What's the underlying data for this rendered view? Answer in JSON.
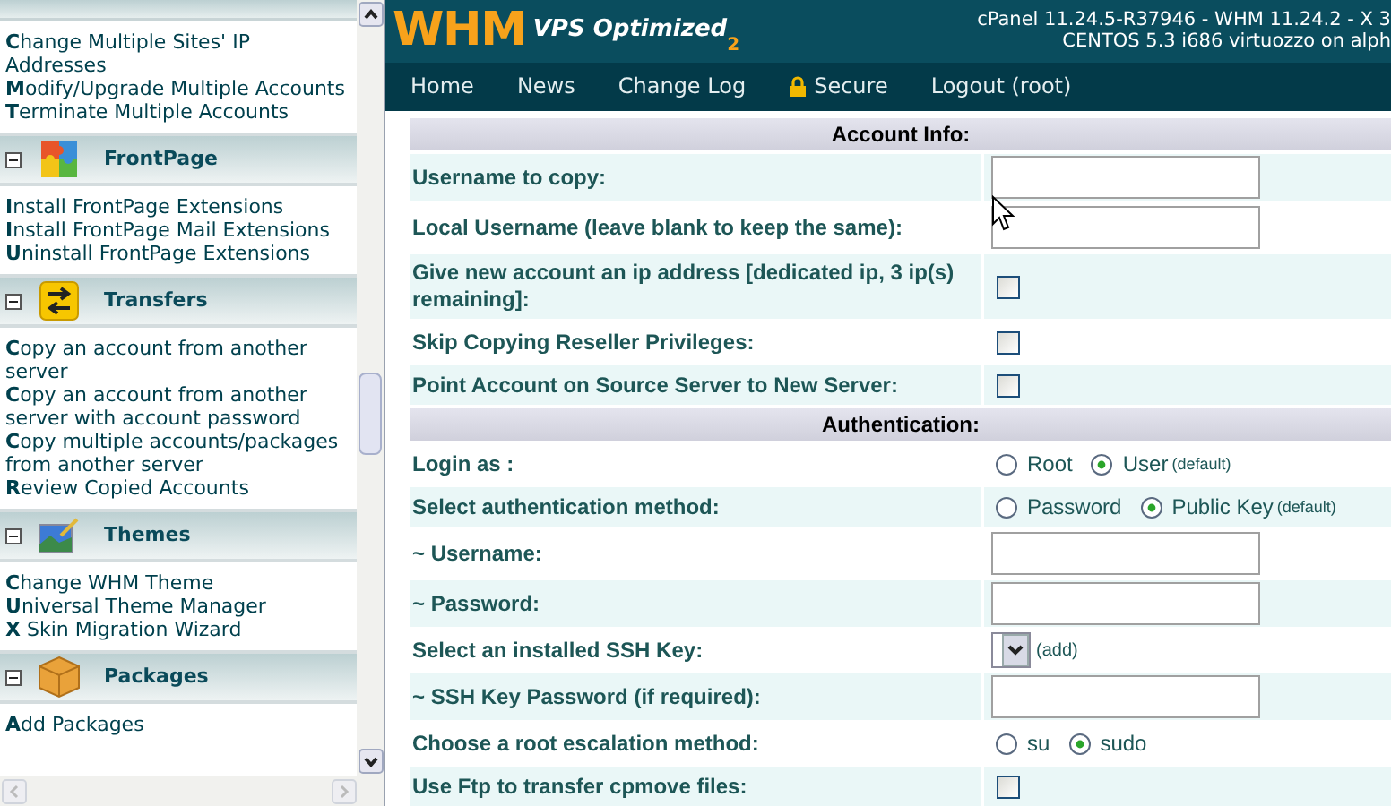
{
  "sidebar": {
    "top_items": [
      "**C**hange Multiple Sites' IP Addresses",
      "**M**odify/Upgrade Multiple Accounts",
      "**T**erminate Multiple Accounts"
    ],
    "sections": [
      {
        "title": "FrontPage",
        "kind": "puzzle",
        "expanded": true,
        "items": [
          "**I**nstall FrontPage Extensions",
          "**I**nstall FrontPage Mail Extensions",
          "**U**ninstall FrontPage Extensions"
        ]
      },
      {
        "title": "Transfers",
        "kind": "arrows",
        "expanded": true,
        "items": [
          "**C**opy an account from another server",
          "**C**opy an account from another server with account password",
          "**C**opy multiple accounts/packages from another server",
          "**R**eview Copied Accounts"
        ]
      },
      {
        "title": "Themes",
        "kind": "picture",
        "expanded": true,
        "items": [
          "**C**hange WHM Theme",
          "**U**niversal Theme Manager",
          "**X** Skin Migration Wizard"
        ]
      },
      {
        "title": "Packages",
        "kind": "box",
        "expanded": true,
        "items": [
          "**A**dd Packages"
        ]
      }
    ]
  },
  "header": {
    "logo": "WHM",
    "logo_subtitle": "VPS Optimized",
    "logo_edition": "2",
    "version_lines": [
      "cPanel 11.24.5-R37946 - WHM 11.24.2 - X 3",
      "CENTOS 5.3 i686 virtuozzo on alph"
    ]
  },
  "nav": [
    {
      "label": "Home",
      "lock": false
    },
    {
      "label": "News",
      "lock": false
    },
    {
      "label": "Change Log",
      "lock": false
    },
    {
      "label": "Secure",
      "lock": true
    },
    {
      "label": "Logout (root)",
      "lock": false
    }
  ],
  "form": {
    "sections": [
      {
        "title": "Account Info:",
        "rows": [
          {
            "label": "Username to copy:",
            "kind": "text"
          },
          {
            "label": "Local Username (leave blank to keep the same):",
            "kind": "text"
          },
          {
            "label": "Give new account an ip address [dedicated ip, 3 ip(s) remaining]:",
            "kind": "checkbox",
            "checked": false
          },
          {
            "label": "Skip Copying Reseller Privileges:",
            "kind": "checkbox",
            "checked": false
          },
          {
            "label": "Point Account on Source Server to New Server:",
            "kind": "checkbox",
            "checked": false
          }
        ]
      },
      {
        "title": "Authentication:",
        "rows": [
          {
            "label": "Login as :",
            "kind": "radio",
            "options": [
              {
                "label": "Root",
                "selected": false
              },
              {
                "label": "User",
                "note": "(default)",
                "selected": true
              }
            ]
          },
          {
            "label": "Select authentication method:",
            "kind": "radio",
            "options": [
              {
                "label": "Password",
                "selected": false
              },
              {
                "label": "Public Key",
                "note": "(default)",
                "selected": true
              }
            ]
          },
          {
            "label": "~ Username:",
            "kind": "text"
          },
          {
            "label": "~ Password:",
            "kind": "text"
          },
          {
            "label": "Select an installed SSH Key:",
            "kind": "select",
            "link": "(add)"
          },
          {
            "label": "~ SSH Key Password (if required):",
            "kind": "text"
          },
          {
            "label": "Choose a root escalation method:",
            "kind": "radio",
            "options": [
              {
                "label": "su",
                "selected": false
              },
              {
                "label": "sudo",
                "selected": true
              }
            ]
          },
          {
            "label": "Use Ftp to transfer cpmove files:",
            "kind": "checkbox",
            "checked": false
          }
        ]
      }
    ]
  }
}
